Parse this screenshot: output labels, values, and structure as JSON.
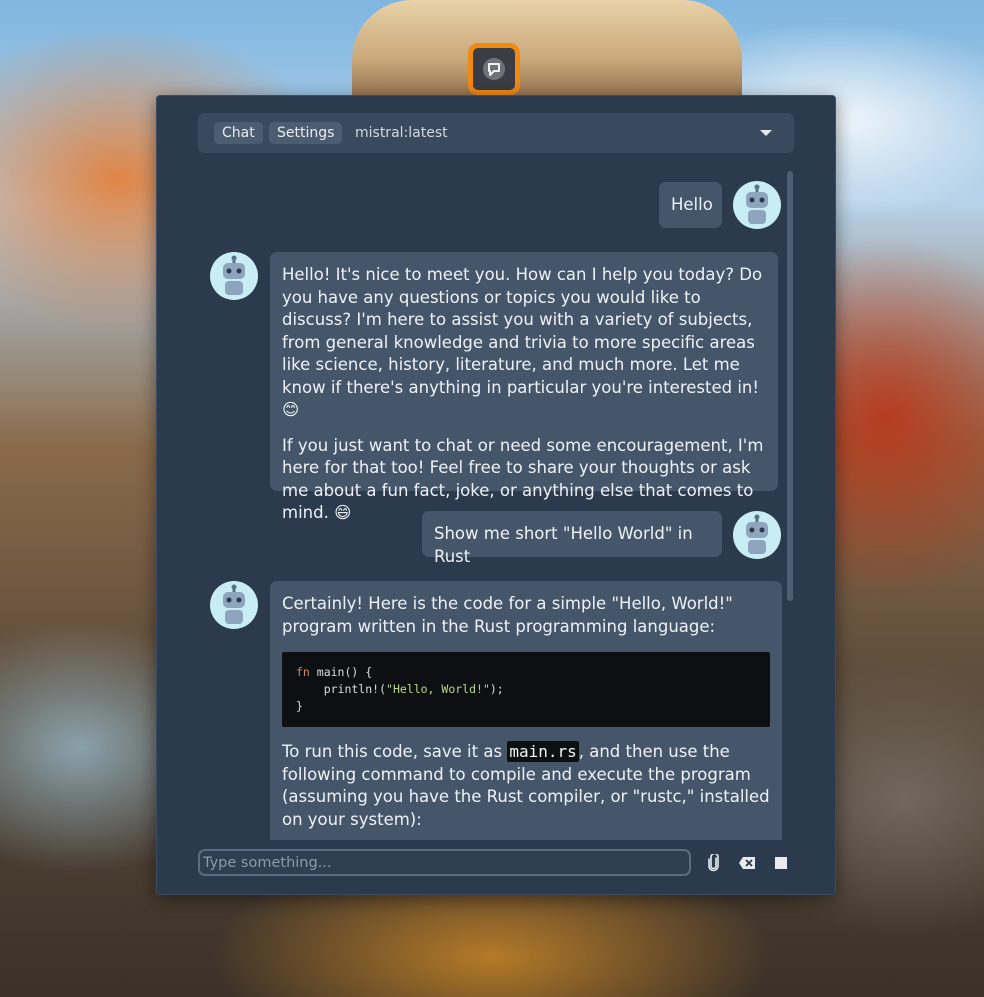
{
  "launcher": {
    "icon": "chat-app-icon"
  },
  "topbar": {
    "tabs": [
      "Chat",
      "Settings"
    ],
    "model": "mistral:latest"
  },
  "messages": [
    {
      "role": "user",
      "text": "Hello"
    },
    {
      "role": "assistant",
      "paragraphs": [
        "Hello! It's nice to meet you. How can I help you today? Do you have any questions or topics you would like to discuss? I'm here to assist you with a variety of subjects, from general knowledge and trivia to more specific areas like science, history, literature, and much more. Let me know if there's anything in particular you're interested in! 😊",
        "If you just want to chat or need some encouragement, I'm here for that too! Feel free to share your thoughts or ask me about a fun fact, joke, or anything else that comes to mind. 😄"
      ]
    },
    {
      "role": "user",
      "text": "Show me short \"Hello World\" in Rust"
    },
    {
      "role": "assistant",
      "intro": "Certainly! Here is the code for a simple \"Hello, World!\" program written in the Rust programming language:",
      "code": {
        "kw_fn": "fn",
        "line1_rest": " main() {",
        "line2_pre": "    println!(",
        "line2_str": "\"Hello, World!\"",
        "line2_post": ");",
        "line3": "}"
      },
      "run_pre": "To run this code, save it as ",
      "run_code": "main.rs",
      "run_post": ", and then use the following command to compile and execute the program (assuming you have the Rust compiler, or \"rustc,\" installed on your system):"
    }
  ],
  "input": {
    "placeholder": "Type something..."
  },
  "icons": {
    "attach": "paperclip-icon",
    "clear": "backspace-icon",
    "stop": "stop-icon"
  }
}
